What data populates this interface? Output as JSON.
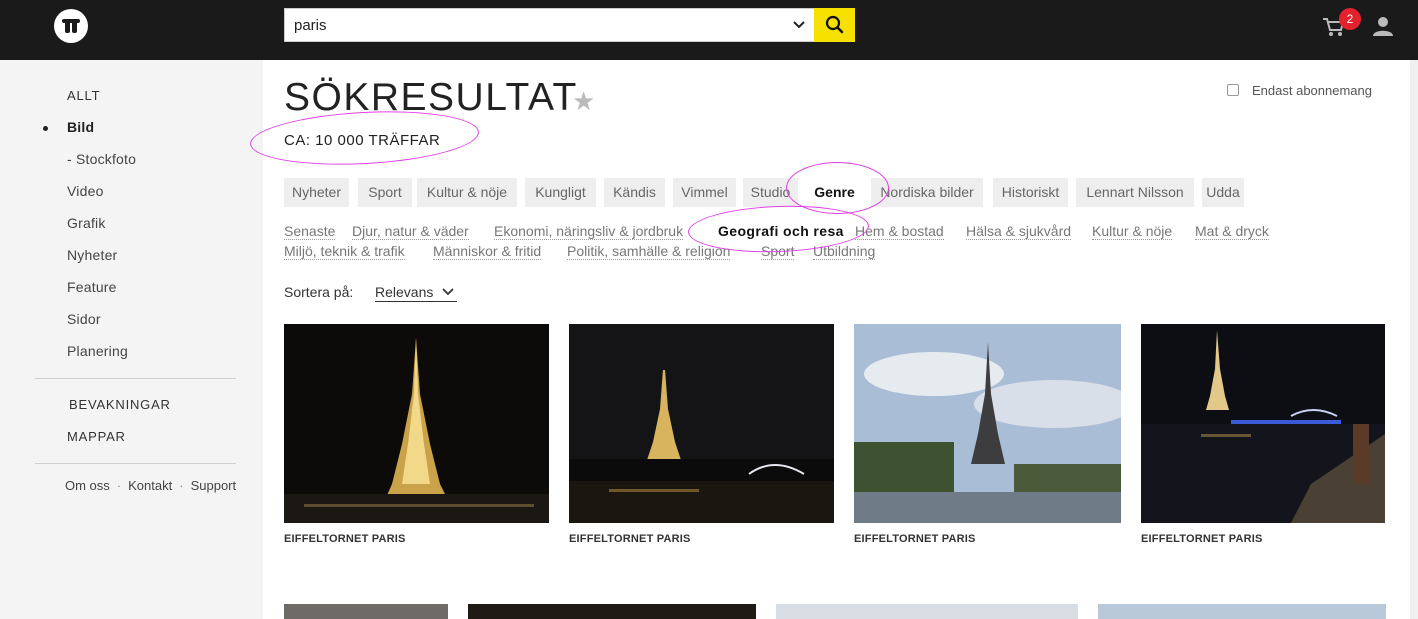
{
  "search": {
    "value": "paris"
  },
  "cart": {
    "count": "2"
  },
  "sidebar": {
    "items": [
      {
        "label": "ALLT"
      },
      {
        "label": "Bild"
      },
      {
        "label": "- Stockfoto"
      },
      {
        "label": "Video"
      },
      {
        "label": "Grafik"
      },
      {
        "label": "Nyheter"
      },
      {
        "label": "Feature"
      },
      {
        "label": "Sidor"
      },
      {
        "label": "Planering"
      }
    ],
    "sections": [
      {
        "label": "BEVAKNINGAR"
      },
      {
        "label": "MAPPAR"
      }
    ],
    "footer": [
      {
        "label": "Om oss"
      },
      {
        "label": "Kontakt"
      },
      {
        "label": "Support"
      }
    ],
    "separator": "·"
  },
  "main": {
    "title": "SÖKRESULTAT",
    "star": "★",
    "hits": "CA: 10 000 TRÄFFAR",
    "subscription_only": "Endast abonnemang",
    "categories": [
      {
        "label": "Nyheter"
      },
      {
        "label": "Sport"
      },
      {
        "label": "Kultur & nöje"
      },
      {
        "label": "Kungligt"
      },
      {
        "label": "Kändis"
      },
      {
        "label": "Vimmel"
      },
      {
        "label": "Studio"
      },
      {
        "label": "Genre",
        "active": true
      },
      {
        "label": "Nordiska bilder"
      },
      {
        "label": "Historiskt"
      },
      {
        "label": "Lennart Nilsson"
      },
      {
        "label": "Udda"
      }
    ],
    "subcategories": [
      {
        "label": "Senaste"
      },
      {
        "label": "Djur, natur & väder"
      },
      {
        "label": "Ekonomi, näringsliv & jordbruk"
      },
      {
        "label": "Geografi och resa",
        "active": true
      },
      {
        "label": "Hem & bostad"
      },
      {
        "label": "Hälsa & sjukvård"
      },
      {
        "label": "Kultur & nöje"
      },
      {
        "label": "Mat & dryck"
      },
      {
        "label": "Miljö, teknik & trafik"
      },
      {
        "label": "Människor & fritid"
      },
      {
        "label": "Politik, samhälle & religion"
      },
      {
        "label": "Sport"
      },
      {
        "label": "Utbildning"
      }
    ],
    "sort": {
      "label": "Sortera på:",
      "value": "Relevans"
    },
    "results": [
      {
        "caption": "EIFFELTORNET PARIS"
      },
      {
        "caption": "EIFFELTORNET PARIS"
      },
      {
        "caption": "EIFFELTORNET PARIS"
      },
      {
        "caption": "EIFFELTORNET PARIS"
      }
    ]
  },
  "colors": {
    "topbar": "#1a1a1a",
    "accent": "#f5e000",
    "badge": "#e3222e",
    "annotation": "#e040e6"
  }
}
